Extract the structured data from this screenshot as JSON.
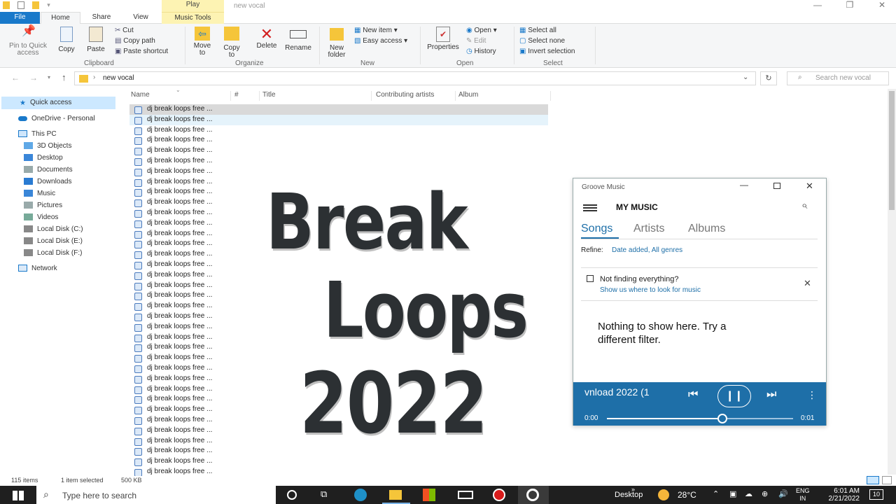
{
  "window": {
    "title": "new vocal",
    "play_context": "Play",
    "min": "—",
    "max": "❐",
    "close": "✕"
  },
  "tabs": {
    "file": "File",
    "home": "Home",
    "share": "Share",
    "view": "View",
    "music_tools": "Music Tools"
  },
  "ribbon": {
    "pin": "Pin to Quick access",
    "copy": "Copy",
    "paste": "Paste",
    "cut": "Cut",
    "copy_path": "Copy path",
    "paste_shortcut": "Paste shortcut",
    "clipboard": "Clipboard",
    "move_to": "Move to",
    "copy_to": "Copy to",
    "delete": "Delete",
    "rename": "Rename",
    "organize": "Organize",
    "new_folder": "New folder",
    "new_item": "New item",
    "easy_access": "Easy access",
    "new": "New",
    "properties": "Properties",
    "open": "Open",
    "edit": "Edit",
    "history": "History",
    "open_group": "Open",
    "select_all": "Select all",
    "select_none": "Select none",
    "invert_selection": "Invert selection",
    "select": "Select"
  },
  "address": {
    "path": "new vocal",
    "search_placeholder": "Search new vocal"
  },
  "nav": {
    "quick_access": "Quick access",
    "onedrive": "OneDrive - Personal",
    "this_pc": "This PC",
    "items": [
      "3D Objects",
      "Desktop",
      "Documents",
      "Downloads",
      "Music",
      "Pictures",
      "Videos",
      "Local Disk (C:)",
      "Local Disk (E:)",
      "Local Disk (F:)"
    ],
    "network": "Network"
  },
  "columns": {
    "name": "Name",
    "num": "#",
    "title": "Title",
    "artists": "Contributing artists",
    "album": "Album"
  },
  "file_name": "dj break loops free ...",
  "status": {
    "count": "115 items",
    "selected": "1 item selected",
    "size": "500 KB"
  },
  "overlay": {
    "line1": "Break",
    "line2": "Loops",
    "line3": "2022"
  },
  "groove": {
    "title": "Groove Music",
    "header": "MY MUSIC",
    "tab_songs": "Songs",
    "tab_artists": "Artists",
    "tab_albums": "Albums",
    "refine_label": "Refine:",
    "refine_value": "Date added, All genres",
    "notice": "Not finding everything?",
    "notice_link": "Show us where to look for music",
    "empty_line1": "Nothing to show here. Try a",
    "empty_line2": "different filter.",
    "now_playing": "vnload 2022 (1",
    "time_start": "0:00",
    "time_end": "0:01",
    "progress": 0.62
  },
  "taskbar": {
    "search": "Type here to search",
    "desktop": "Desktop",
    "temp": "28°C",
    "lang1": "ENG",
    "lang2": "IN",
    "time": "6:01 AM",
    "date": "2/21/2022",
    "notif": "10"
  },
  "colors": {
    "accent": "#1979ca",
    "groove_bar": "#1e6fa8",
    "selected_row": "#d9d9d9",
    "hover_row": "#e5f3fb"
  }
}
